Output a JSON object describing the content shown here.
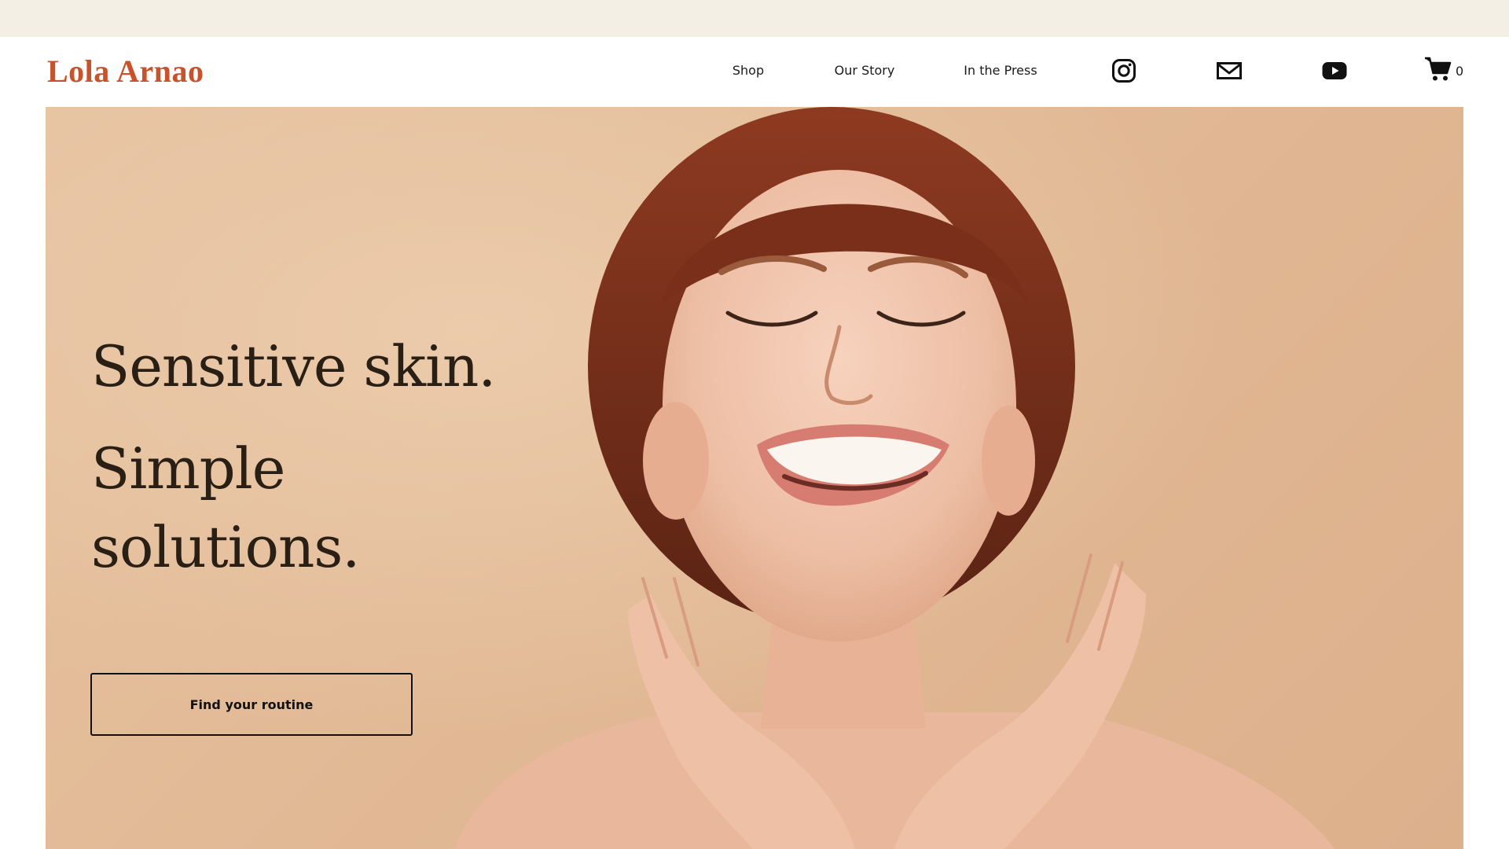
{
  "brand": {
    "name": "Lola Arnao",
    "color": "#c8532b"
  },
  "nav": {
    "links": [
      "Shop",
      "Our Story",
      "In the Press"
    ],
    "social": [
      "instagram-icon",
      "mail-icon",
      "youtube-icon"
    ],
    "cart": {
      "icon": "cart-icon",
      "count": "0"
    }
  },
  "hero": {
    "headline_1": "Sensitive skin.",
    "headline_2": "Simple",
    "headline_3": "solutions.",
    "cta_label": "Find your routine",
    "background_color": "#e2b995",
    "image": "smiling-woman-portrait"
  }
}
